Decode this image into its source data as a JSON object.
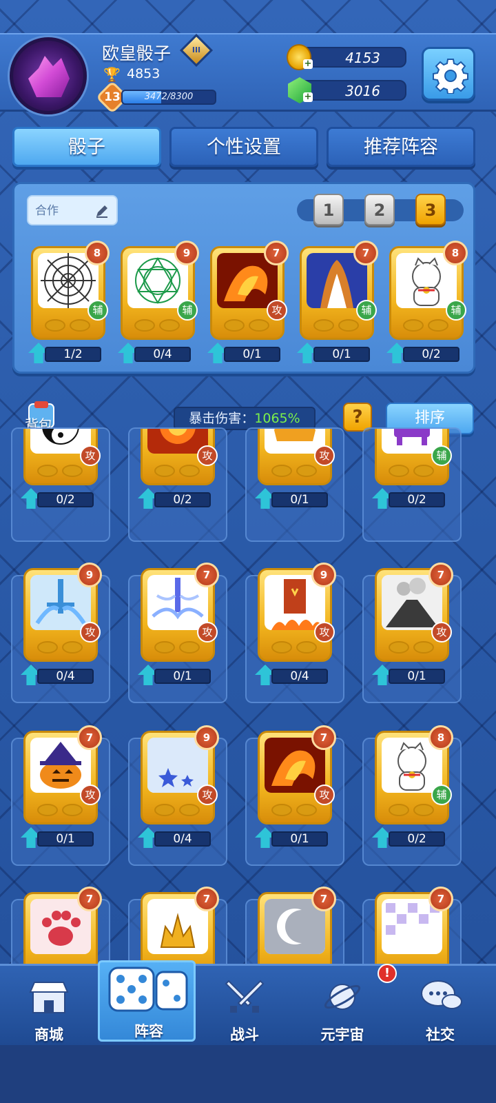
{
  "header": {
    "player_name": "欧皇骰子",
    "rank_icon": "rank-badge-icon",
    "trophies": "4853",
    "level": "13",
    "xp_text": "3472/8300",
    "xp_progress": 0.418,
    "gold": "4153",
    "gems": "3016"
  },
  "tabs": [
    "骰子",
    "个性设置",
    "推荐阵容"
  ],
  "deck": {
    "name": "合作",
    "slots": [
      "1",
      "2",
      "3"
    ],
    "active_slot": 3,
    "dice": [
      {
        "level": "8",
        "role": "辅",
        "upgrade": "1/2",
        "art": "web"
      },
      {
        "level": "9",
        "role": "辅",
        "upgrade": "0/4",
        "art": "magic-circle"
      },
      {
        "level": "7",
        "role": "攻",
        "upgrade": "0/1",
        "art": "fire-dragon"
      },
      {
        "level": "7",
        "role": "辅",
        "upgrade": "0/1",
        "art": "cheetah"
      },
      {
        "level": "8",
        "role": "辅",
        "upgrade": "0/2",
        "art": "lucky-cat"
      }
    ]
  },
  "bag": {
    "label": "背包",
    "crit_label": "暴击伤害：",
    "crit_value": "1065%",
    "help": "?",
    "sort": "排序"
  },
  "inventory": [
    {
      "level": "",
      "role": "攻",
      "upgrade": "0/2",
      "art": "yin-yang"
    },
    {
      "level": "",
      "role": "攻",
      "upgrade": "0/2",
      "art": "fire"
    },
    {
      "level": "",
      "role": "攻",
      "upgrade": "0/1",
      "art": "bull"
    },
    {
      "level": "",
      "role": "辅",
      "upgrade": "0/2",
      "art": "cauldron"
    },
    {
      "level": "9",
      "role": "攻",
      "upgrade": "0/4",
      "art": "ice-sword"
    },
    {
      "level": "7",
      "role": "攻",
      "upgrade": "0/1",
      "art": "wind-sword"
    },
    {
      "level": "9",
      "role": "攻",
      "upgrade": "0/4",
      "art": "banner"
    },
    {
      "level": "7",
      "role": "攻",
      "upgrade": "0/1",
      "art": "volcano"
    },
    {
      "level": "7",
      "role": "攻",
      "upgrade": "0/1",
      "art": "pumpkin"
    },
    {
      "level": "9",
      "role": "攻",
      "upgrade": "0/4",
      "art": "stars"
    },
    {
      "level": "7",
      "role": "攻",
      "upgrade": "0/1",
      "art": "fire-dragon"
    },
    {
      "level": "8",
      "role": "辅",
      "upgrade": "0/2",
      "art": "lucky-cat"
    },
    {
      "level": "7",
      "role": "",
      "upgrade": "",
      "art": "paw"
    },
    {
      "level": "7",
      "role": "",
      "upgrade": "",
      "art": "crown"
    },
    {
      "level": "7",
      "role": "",
      "upgrade": "",
      "art": "moon"
    },
    {
      "level": "7",
      "role": "",
      "upgrade": "",
      "art": "grid"
    }
  ],
  "nav": [
    {
      "label": "商城",
      "icon": "shop-icon"
    },
    {
      "label": "阵容",
      "icon": "dice-icon"
    },
    {
      "label": "战斗",
      "icon": "swords-icon"
    },
    {
      "label": "元宇宙",
      "icon": "planet-icon"
    },
    {
      "label": "社交",
      "icon": "chat-icon"
    }
  ],
  "nav_badge": "!",
  "colors": {
    "accent": "#4ea8f0",
    "gold": "#f0a300",
    "crit": "#7cf04a"
  }
}
